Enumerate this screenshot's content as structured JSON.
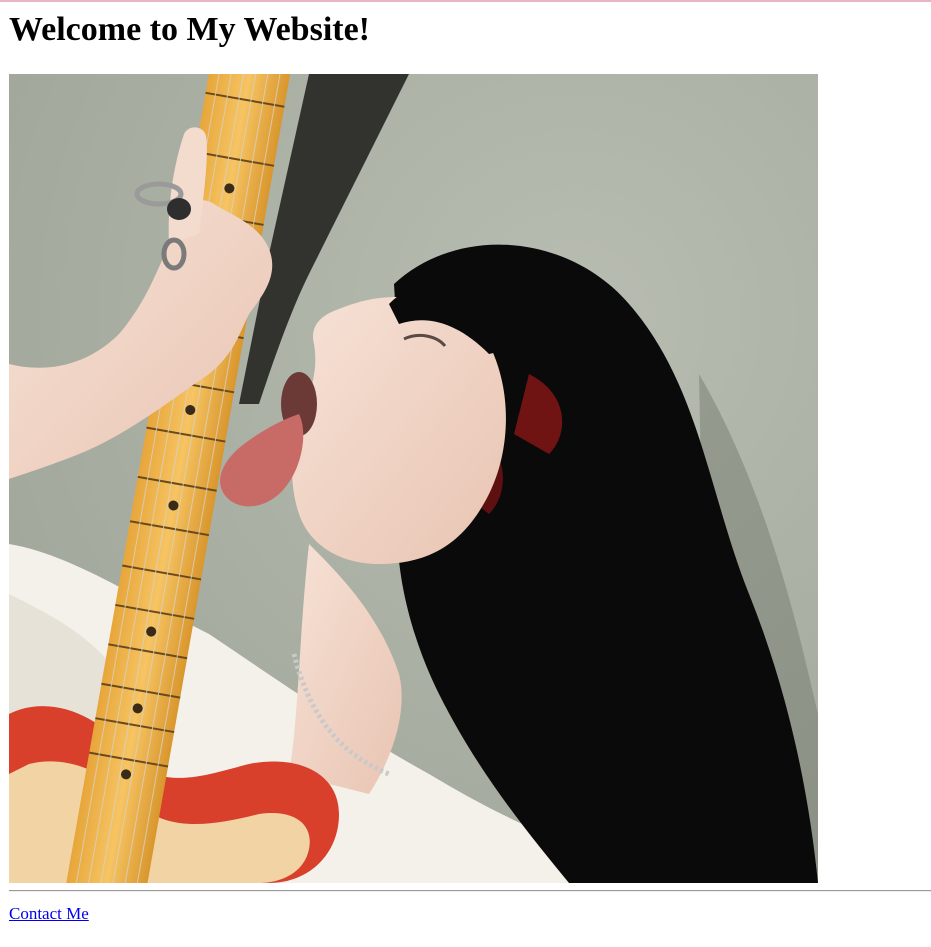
{
  "page": {
    "heading": "Welcome to My Website!",
    "image": {
      "subject": "person-licking-guitar-neck",
      "colors": {
        "wall": "#a8aea2",
        "hair": "#0b0a0b",
        "skin": "#f0d6c8",
        "fretboard": "#f3b64a",
        "guitar_body": "#d8402c",
        "shirt": "#f4f1ea",
        "tongue": "#c86a66"
      }
    },
    "link": {
      "label": "Contact Me",
      "color": "#0000ee"
    },
    "top_border_color": "#e6b7c3"
  }
}
